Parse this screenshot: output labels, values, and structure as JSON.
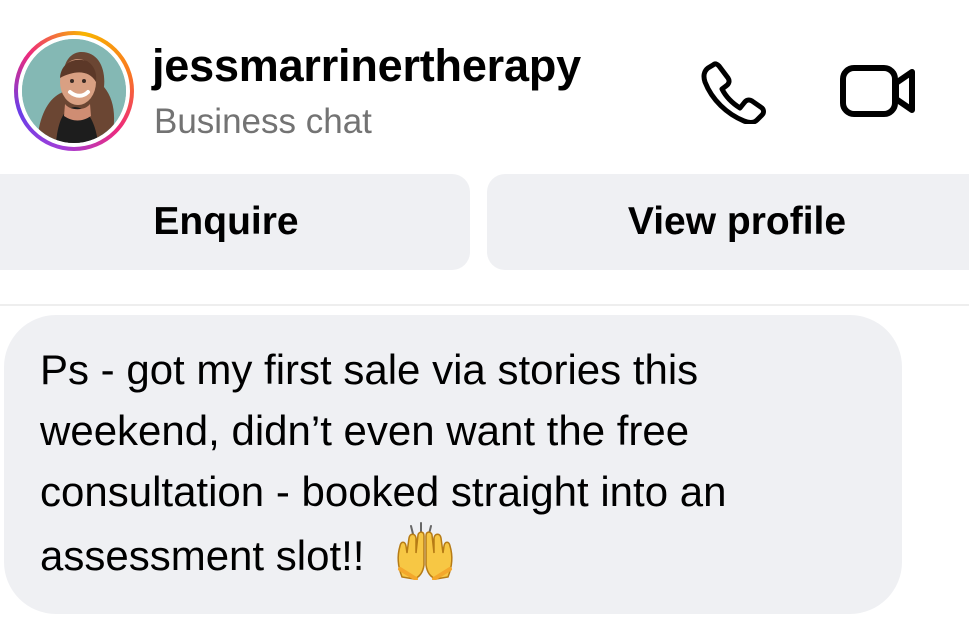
{
  "header": {
    "username": "jessmarrinertherapy",
    "subtitle": "Business chat",
    "call_icon": "phone-icon",
    "video_icon": "video-camera-icon"
  },
  "actions": {
    "enquire": "Enquire",
    "view_profile": "View profile"
  },
  "message": {
    "text": "Ps - got my first sale via stories this weekend, didn’t even want the free consultation - booked straight into an assessment slot!!",
    "emoji": "raising-hands-emoji"
  },
  "colors": {
    "background": "#ffffff",
    "bubble": "#eff0f3",
    "secondary_text": "#737373",
    "story_ring_start": "#f8b400",
    "story_ring_middle": "#ee2a7b",
    "story_ring_end": "#6a3ee8"
  }
}
